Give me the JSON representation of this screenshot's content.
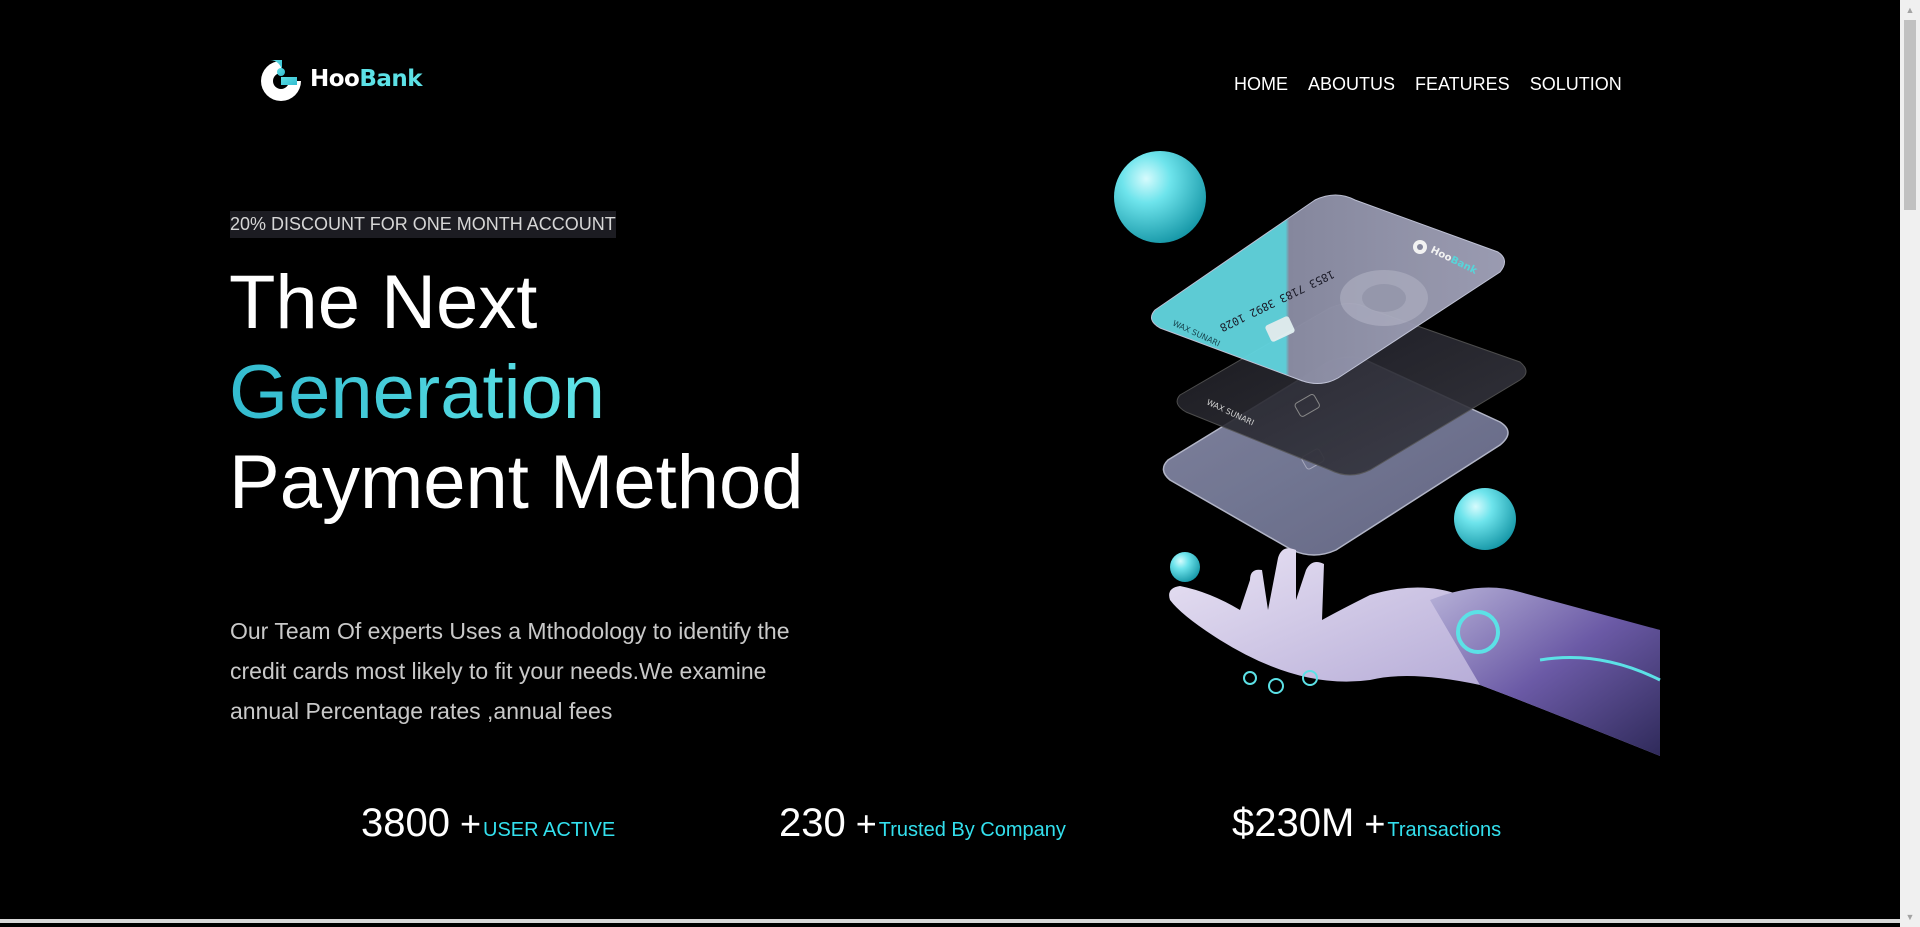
{
  "brand": {
    "name_part1": "Hoo",
    "name_part2": "Bank",
    "accent_color": "#5ce1e6"
  },
  "nav": {
    "items": [
      "HOME",
      "ABOUTUS",
      "FEATURES",
      "SOLUTION"
    ]
  },
  "hero": {
    "discount": "20% DISCOUNT FOR ONE MONTH ACCOUNT",
    "headline_line1": "The Next",
    "headline_line2": "Generation",
    "headline_line3": "Payment Method",
    "description": "Our Team Of experts Uses a Mthodology to identify the credit cards most likely to fit your needs.We examine annual Percentage rates ,annual fees"
  },
  "illustration": {
    "card_number": "1853 7183 3892 1028",
    "card_holder": "WAX SUNARI",
    "card_brand_part1": "Hoo",
    "card_brand_part2": "Bank",
    "icons": [
      "robot-hand",
      "credit-card",
      "sphere"
    ]
  },
  "stats": [
    {
      "value": "3800",
      "plus": "+",
      "label": "USER ACTIVE"
    },
    {
      "value": "230",
      "plus": "+",
      "label": "Trusted By Company"
    },
    {
      "value": "$230M",
      "plus": "+",
      "label": "Transactions"
    }
  ]
}
